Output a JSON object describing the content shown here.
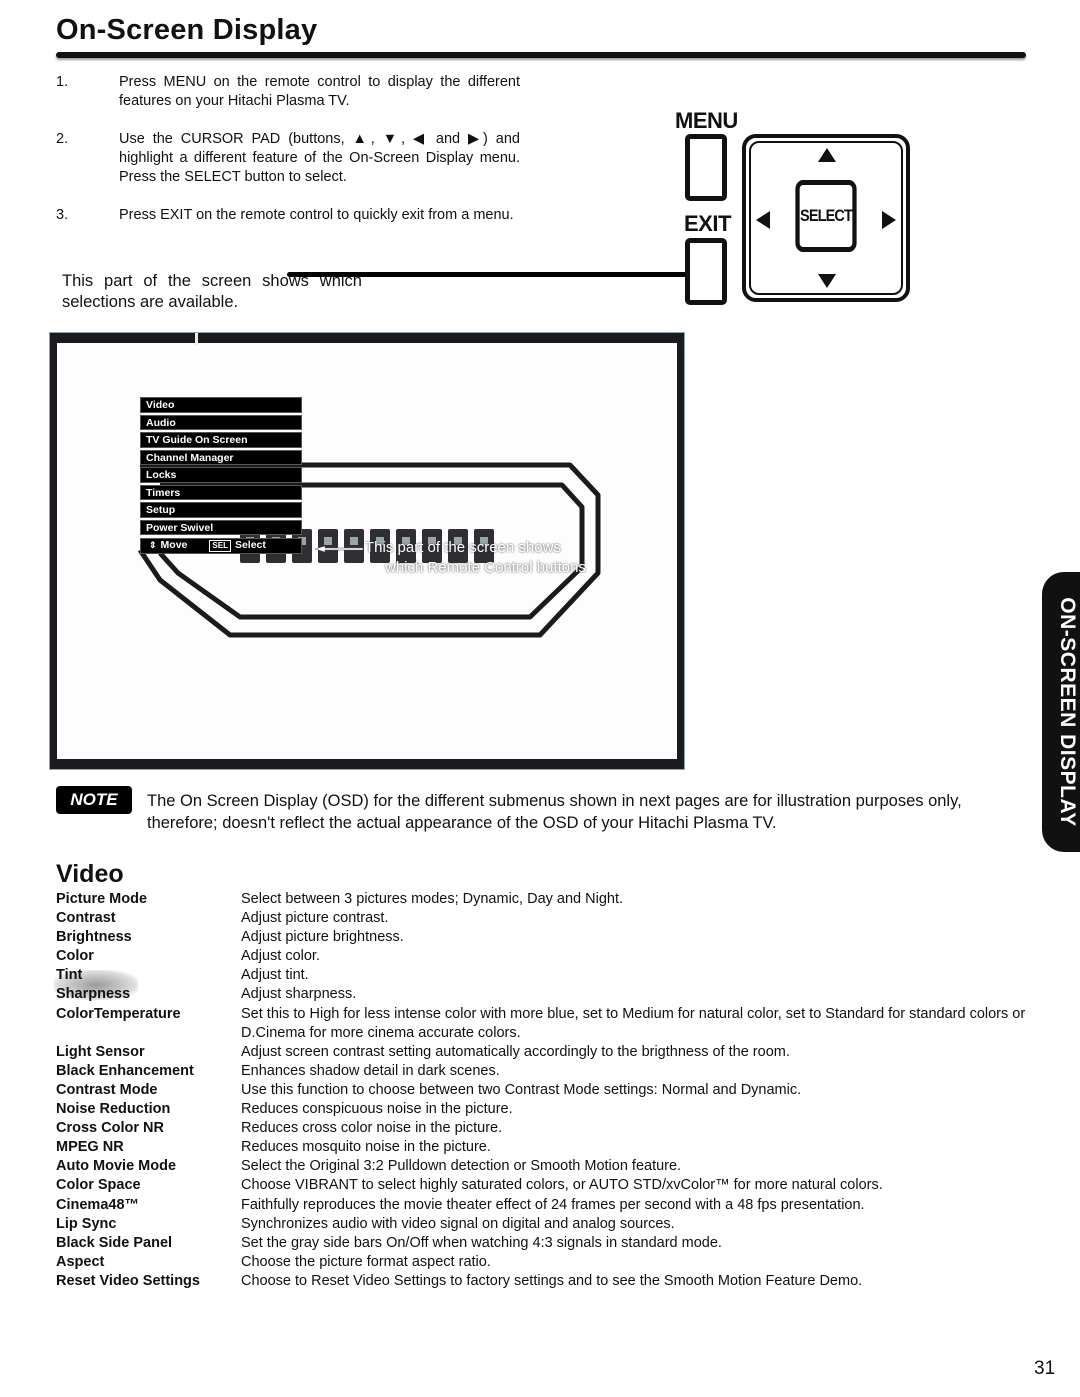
{
  "page": {
    "title": "On-Screen Display",
    "page_number": "31",
    "side_tab": "ON-SCREEN DISPLAY"
  },
  "steps": [
    {
      "num": "1.",
      "text": "Press MENU on the remote control to display the different features on your Hitachi Plasma TV."
    },
    {
      "num": "2.",
      "text": "Use the CURSOR PAD (buttons, ▲, ▼, ◀ and ▶) and highlight a different feature of the On-Screen Display menu. Press the SELECT button to select."
    },
    {
      "num": "3.",
      "text": "Press EXIT on the remote control to quickly exit from a menu."
    }
  ],
  "callout": "This part of the screen shows which selections are available.",
  "remote": {
    "menu_label": "MENU",
    "exit_label": "EXIT",
    "select_label": "SELECT",
    "icons": [
      "arrow-up-icon",
      "arrow-down-icon",
      "arrow-left-icon",
      "arrow-right-icon"
    ]
  },
  "osd": {
    "menu_items": [
      "Video",
      "Audio",
      "TV Guide On Screen",
      "Channel Manager",
      "Locks",
      "Timers",
      "Setup",
      "Power Swivel"
    ],
    "footer_move": "Move",
    "footer_sel_badge": "SEL",
    "footer_select": "Select",
    "overlay_text_line1": "This part of the screen shows",
    "overlay_text_line2": "which Remote Control buttons"
  },
  "note": {
    "badge": "NOTE",
    "text": "The On Screen Display (OSD) for the different submenus shown in next pages are for illustration purposes only, therefore; doesn't reflect the actual appearance of the OSD of your Hitachi Plasma TV."
  },
  "video": {
    "heading": "Video",
    "items": [
      {
        "term": "Picture Mode",
        "desc": "Select between 3 pictures modes; Dynamic, Day and Night."
      },
      {
        "term": "Contrast",
        "desc": "Adjust picture contrast."
      },
      {
        "term": "Brightness",
        "desc": "Adjust picture brightness."
      },
      {
        "term": "Color",
        "desc": "Adjust color."
      },
      {
        "term": "Tint",
        "desc": "Adjust tint."
      },
      {
        "term": "Sharpness",
        "desc": "Adjust sharpness."
      },
      {
        "term": "ColorTemperature",
        "desc": "Set this to High for less intense color with more blue, set to Medium for natural color, set to Standard for standard colors or D.Cinema for more cinema accurate colors."
      },
      {
        "term": "Light Sensor",
        "desc": "Adjust screen contrast setting automatically accordingly to the brigthness of the room."
      },
      {
        "term": "Black Enhancement",
        "desc": "Enhances shadow detail in dark scenes."
      },
      {
        "term": "Contrast Mode",
        "desc": "Use this function to choose between two Contrast Mode settings: Normal and Dynamic."
      },
      {
        "term": "Noise Reduction",
        "desc": "Reduces conspicuous noise in the picture."
      },
      {
        "term": "Cross Color NR",
        "desc": "Reduces cross color noise in the picture."
      },
      {
        "term": "MPEG NR",
        "desc": "Reduces mosquito noise in the picture."
      },
      {
        "term": "Auto Movie Mode",
        "desc": "Select the Original 3:2 Pulldown detection or Smooth Motion feature."
      },
      {
        "term": "Color Space",
        "desc": "Choose VIBRANT to select highly saturated colors, or AUTO STD/xvColor™ for more natural colors."
      },
      {
        "term": "Cinema48™",
        "desc": "Faithfully reproduces the movie theater effect of 24 frames per second with a 48 fps presentation."
      },
      {
        "term": "Lip Sync",
        "desc": "Synchronizes audio with video signal on digital and analog sources."
      },
      {
        "term": "Black Side Panel",
        "desc": "Set the gray side bars On/Off when watching 4:3 signals in standard mode."
      },
      {
        "term": "Aspect",
        "desc": "Choose the picture format aspect ratio."
      },
      {
        "term": "Reset Video Settings",
        "desc": "Choose to Reset Video Settings to factory settings and to see the Smooth Motion Feature Demo."
      }
    ]
  }
}
